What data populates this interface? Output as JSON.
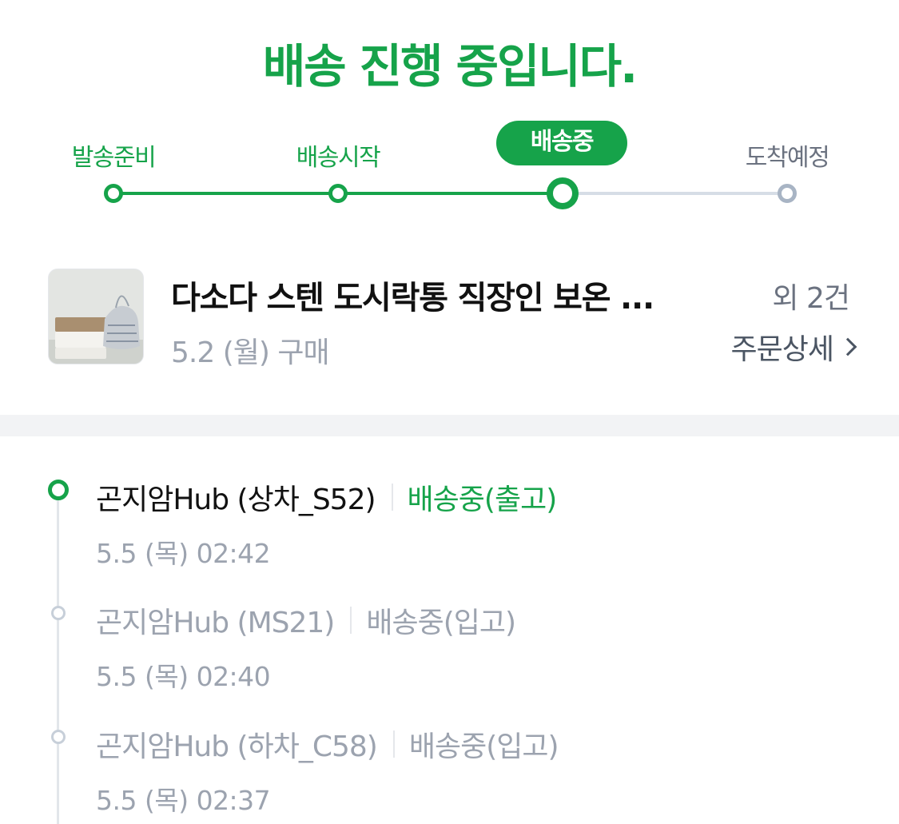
{
  "header": {
    "title": "배송 진행 중입니다."
  },
  "colors": {
    "accent": "#16a34a",
    "pending": "#6b7280",
    "track_pending": "#d6dde6",
    "dot_pending": "#a8b4c4"
  },
  "stepper": {
    "steps": [
      {
        "label": "발송준비",
        "state": "done"
      },
      {
        "label": "배송시작",
        "state": "done"
      },
      {
        "label": "배송중",
        "state": "current"
      },
      {
        "label": "도착예정",
        "state": "pending"
      }
    ]
  },
  "product": {
    "thumbnail_icon": "lunchbox-photo",
    "name": "다소다 스텐 도시락통 직장인 보온 ...",
    "extra": "외 2건",
    "purchase_date": "5.2 (월) 구매",
    "detail_link": "주문상세",
    "detail_icon": "chevron-right-icon"
  },
  "tracking": {
    "events": [
      {
        "location": "곤지암Hub (상차_S52)",
        "status": "배송중(출고)",
        "time": "5.5 (목) 02:42",
        "active": true
      },
      {
        "location": "곤지암Hub (MS21)",
        "status": "배송중(입고)",
        "time": "5.5 (목) 02:40",
        "active": false
      },
      {
        "location": "곤지암Hub (하차_C58)",
        "status": "배송중(입고)",
        "time": "5.5 (목) 02:37",
        "active": false
      }
    ]
  }
}
